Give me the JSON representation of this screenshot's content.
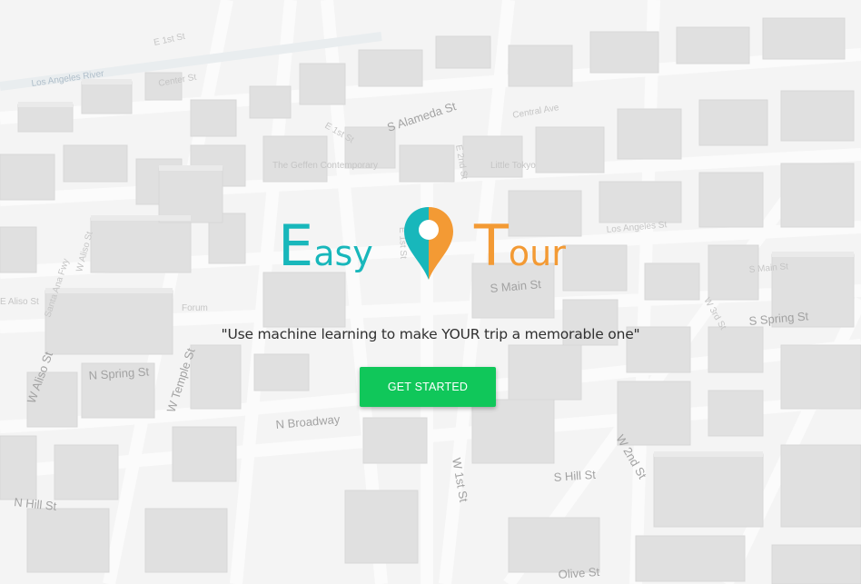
{
  "brand": {
    "easy_cap": "E",
    "easy_rest": "asy",
    "tour_cap": "T",
    "tour_rest": "our",
    "easy_color": "#18b7bb",
    "tour_color": "#f39a34"
  },
  "hero": {
    "tagline": "\"Use machine learning to make YOUR trip a memorable one\"",
    "cta_label": "GET STARTED",
    "cta_color": "#10c75a"
  },
  "map": {
    "labels": [
      "E 1st St",
      "Los Angeles River",
      "Center St",
      "S Alameda St",
      "E 1st St",
      "E 2nd St",
      "Central Ave",
      "Little Tokyo",
      "The Geffen Contemporary",
      "E 1st St",
      "Los Angeles St",
      "W Aliso St",
      "E Aliso St",
      "Santa Ana Fwy",
      "S Main St",
      "S Main St",
      "S Spring St",
      "W 3rd St",
      "Forum",
      "W Aliso St",
      "N Spring St",
      "W Temple St",
      "N Broadway",
      "W 1st St",
      "W 2nd St",
      "S Hill St",
      "N Hill St",
      "Olive St"
    ]
  }
}
